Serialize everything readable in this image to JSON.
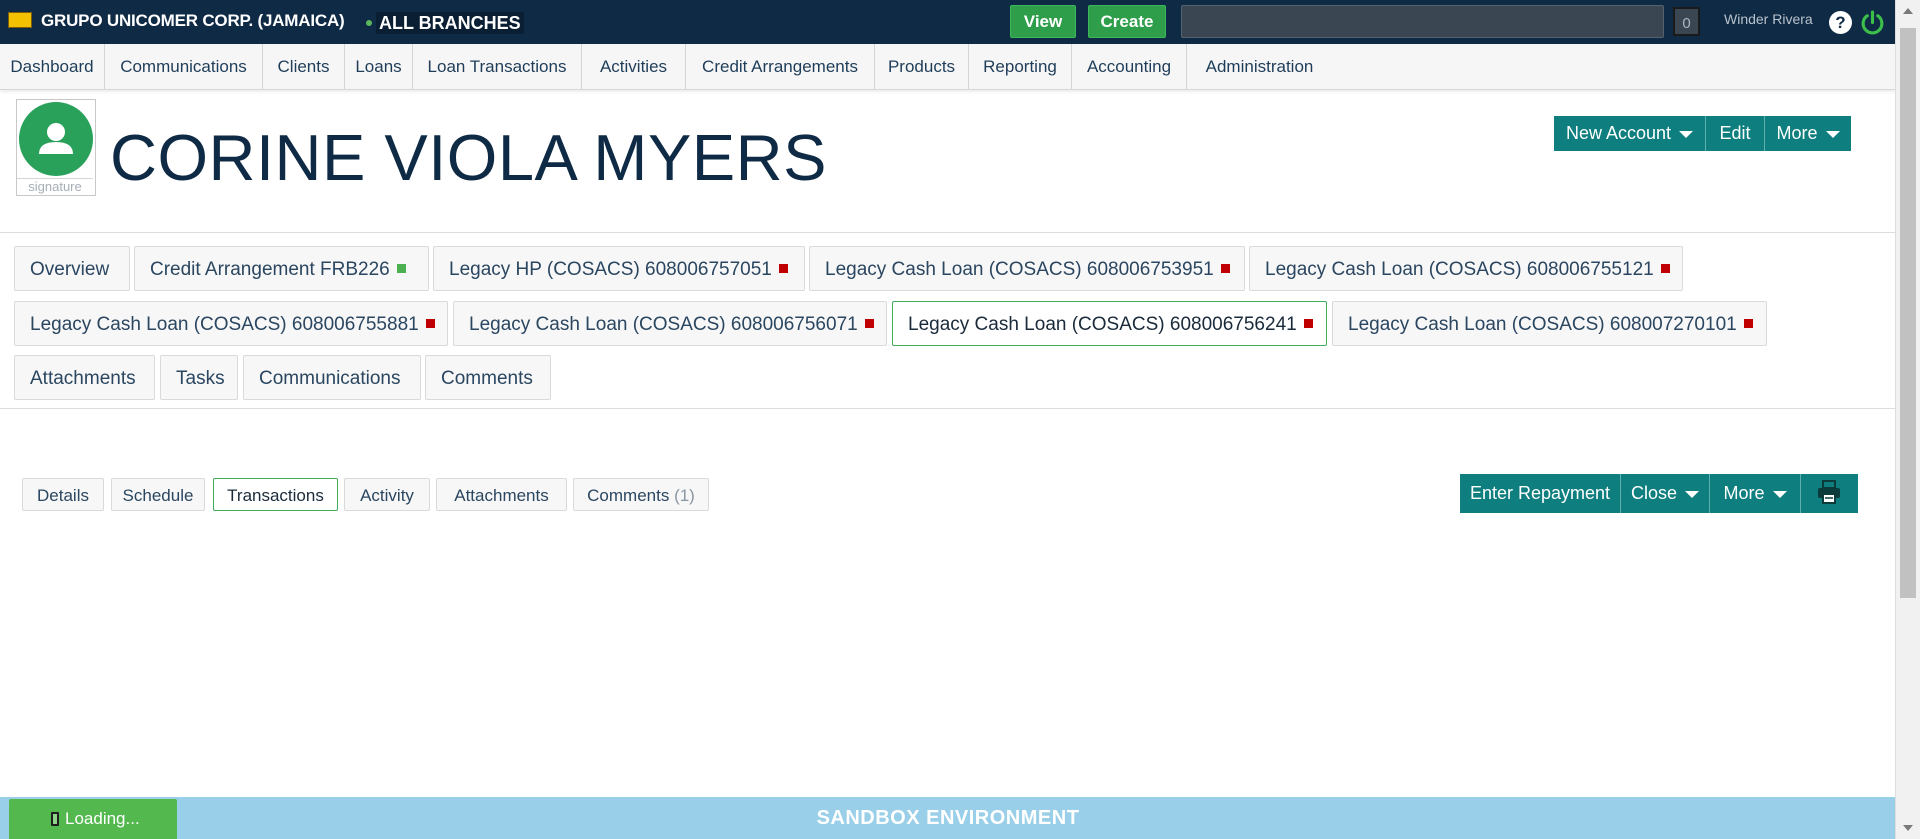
{
  "topbar": {
    "company": "GRUPO UNICOMER CORP. (JAMAICA)",
    "branch": "ALL BRANCHES",
    "view_label": "View",
    "create_label": "Create",
    "search_value": "",
    "notification_count": "0",
    "user_name": "Winder Rivera",
    "help_symbol": "?"
  },
  "nav": {
    "items": [
      "Dashboard",
      "Communications",
      "Clients",
      "Loans",
      "Loan Transactions",
      "Activities",
      "Credit Arrangements",
      "Products",
      "Reporting",
      "Accounting",
      "Administration"
    ]
  },
  "client": {
    "name": "CORINE VIOLA MYERS",
    "signature_label": "signature",
    "actions": {
      "new_account": "New  Account",
      "edit": "Edit",
      "more": "More"
    }
  },
  "tabs": {
    "row1": [
      {
        "label": "Overview",
        "status": ""
      },
      {
        "label": "Credit Arrangement FRB226",
        "status": "green"
      },
      {
        "label": "Legacy HP (COSACS) 608006757051",
        "status": "red"
      },
      {
        "label": "Legacy Cash Loan (COSACS) 608006753951",
        "status": "red"
      },
      {
        "label": "Legacy Cash Loan (COSACS) 608006755121",
        "status": "red"
      }
    ],
    "row2": [
      {
        "label": "Legacy Cash Loan (COSACS) 608006755881",
        "status": "red"
      },
      {
        "label": "Legacy Cash Loan (COSACS) 608006756071",
        "status": "red"
      },
      {
        "label": "Legacy Cash Loan (COSACS) 608006756241",
        "status": "red",
        "active": true
      },
      {
        "label": "Legacy Cash Loan (COSACS) 608007270101",
        "status": "red"
      }
    ],
    "row3": [
      {
        "label": "Attachments"
      },
      {
        "label": "Tasks"
      },
      {
        "label": "Communications"
      },
      {
        "label": "Comments"
      }
    ]
  },
  "subtabs": {
    "details": "Details",
    "schedule": "Schedule",
    "transactions": "Transactions",
    "activity": "Activity",
    "attachments": "Attachments",
    "comments": "Comments",
    "comments_count": "(1)"
  },
  "loan_actions": {
    "enter_repayment": "Enter  Repayment",
    "close": "Close",
    "more": "More",
    "print_icon": "printer-icon"
  },
  "footer": {
    "environment": "SANDBOX ENVIRONMENT",
    "loading": "Loading..."
  },
  "colors": {
    "topbar": "#0f2a45",
    "teal": "#0e7e7e",
    "green_button": "#2e9e4a",
    "status_green": "#4caf50",
    "status_red": "#c00000",
    "active_border": "#3fae5a",
    "footer": "#99cfe8"
  }
}
